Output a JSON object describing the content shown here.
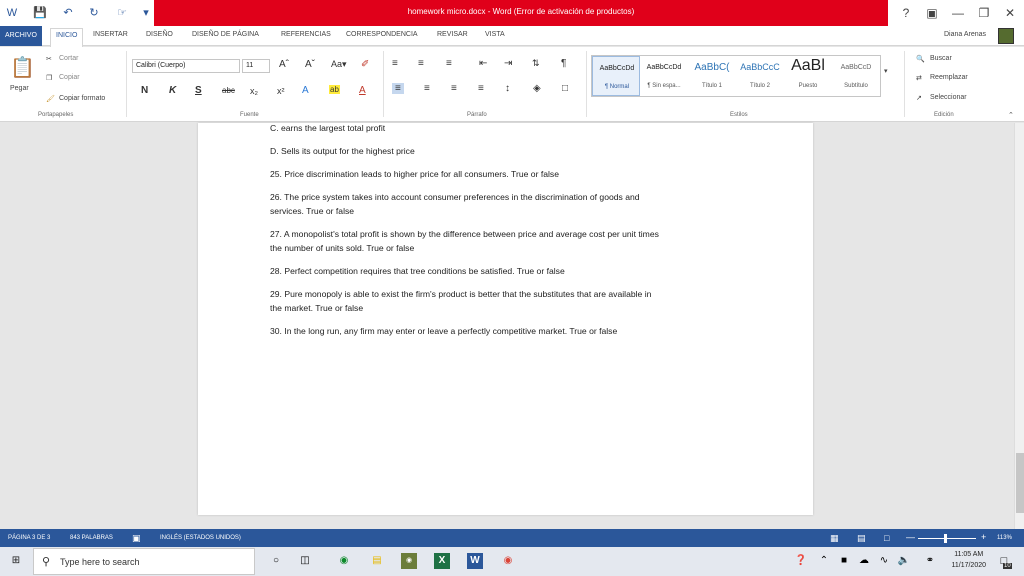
{
  "window": {
    "title": "homework micro.docx - Word (Error de activación de productos)"
  },
  "tabs": [
    "ARCHIVO",
    "INICIO",
    "INSERTAR",
    "DISEÑO",
    "DISEÑO DE PÁGINA",
    "REFERENCIAS",
    "CORRESPONDENCIA",
    "REVISAR",
    "VISTA"
  ],
  "user": "Diana Arenas",
  "ribbon": {
    "clipboard": {
      "paste": "Pegar",
      "cut": "Cortar",
      "copy": "Copiar",
      "format": "Copiar formato",
      "label": "Portapapeles"
    },
    "font": {
      "name": "Calibri (Cuerpo)",
      "size": "11",
      "label": "Fuente"
    },
    "paragraph": {
      "label": "Párrafo"
    },
    "styles": {
      "label": "Estilos",
      "items": [
        {
          "sample": "AaBbCcDd",
          "name": "¶ Normal"
        },
        {
          "sample": "AaBbCcDd",
          "name": "¶ Sin espa..."
        },
        {
          "sample": "AaBbC(",
          "name": "Título 1"
        },
        {
          "sample": "AaBbCcC",
          "name": "Título 2"
        },
        {
          "sample": "AaBl",
          "name": "Puesto"
        },
        {
          "sample": "AaBbCcD",
          "name": "Subtítulo"
        }
      ]
    },
    "editing": {
      "find": "Buscar",
      "replace": "Reemplazar",
      "select": "Seleccionar",
      "label": "Edición"
    }
  },
  "document": {
    "lines": [
      "C. earns the largest total profit",
      "D. Sells its output for the highest price",
      "25. Price discrimination leads to higher price for all consumers. True or false",
      "26. The price system takes into account consumer preferences in the discrimination of goods and",
      "services. True or false",
      "27. A monopolist's total profit is shown by the difference between price and average cost per unit times",
      "the number of units sold. True or false",
      "28. Perfect competition requires that tree conditions be satisfied. True or false",
      "29. Pure monopoly is able to exist the firm's product is better that the substitutes that are available in",
      "the market. True or false",
      "30. In the long run, any firm may enter or leave a perfectly competitive market. True or false"
    ]
  },
  "status": {
    "page": "PÁGINA 3 DE 3",
    "words": "843 PALABRAS",
    "language": "INGLÉS (ESTADOS UNIDOS)",
    "zoom": "113%"
  },
  "taskbar": {
    "search_placeholder": "Type here to search",
    "time": "11:05 AM",
    "date": "11/17/2020",
    "notifications": "10"
  },
  "colors": {
    "accent": "#2b579a",
    "titlebar": "#e0001a"
  }
}
